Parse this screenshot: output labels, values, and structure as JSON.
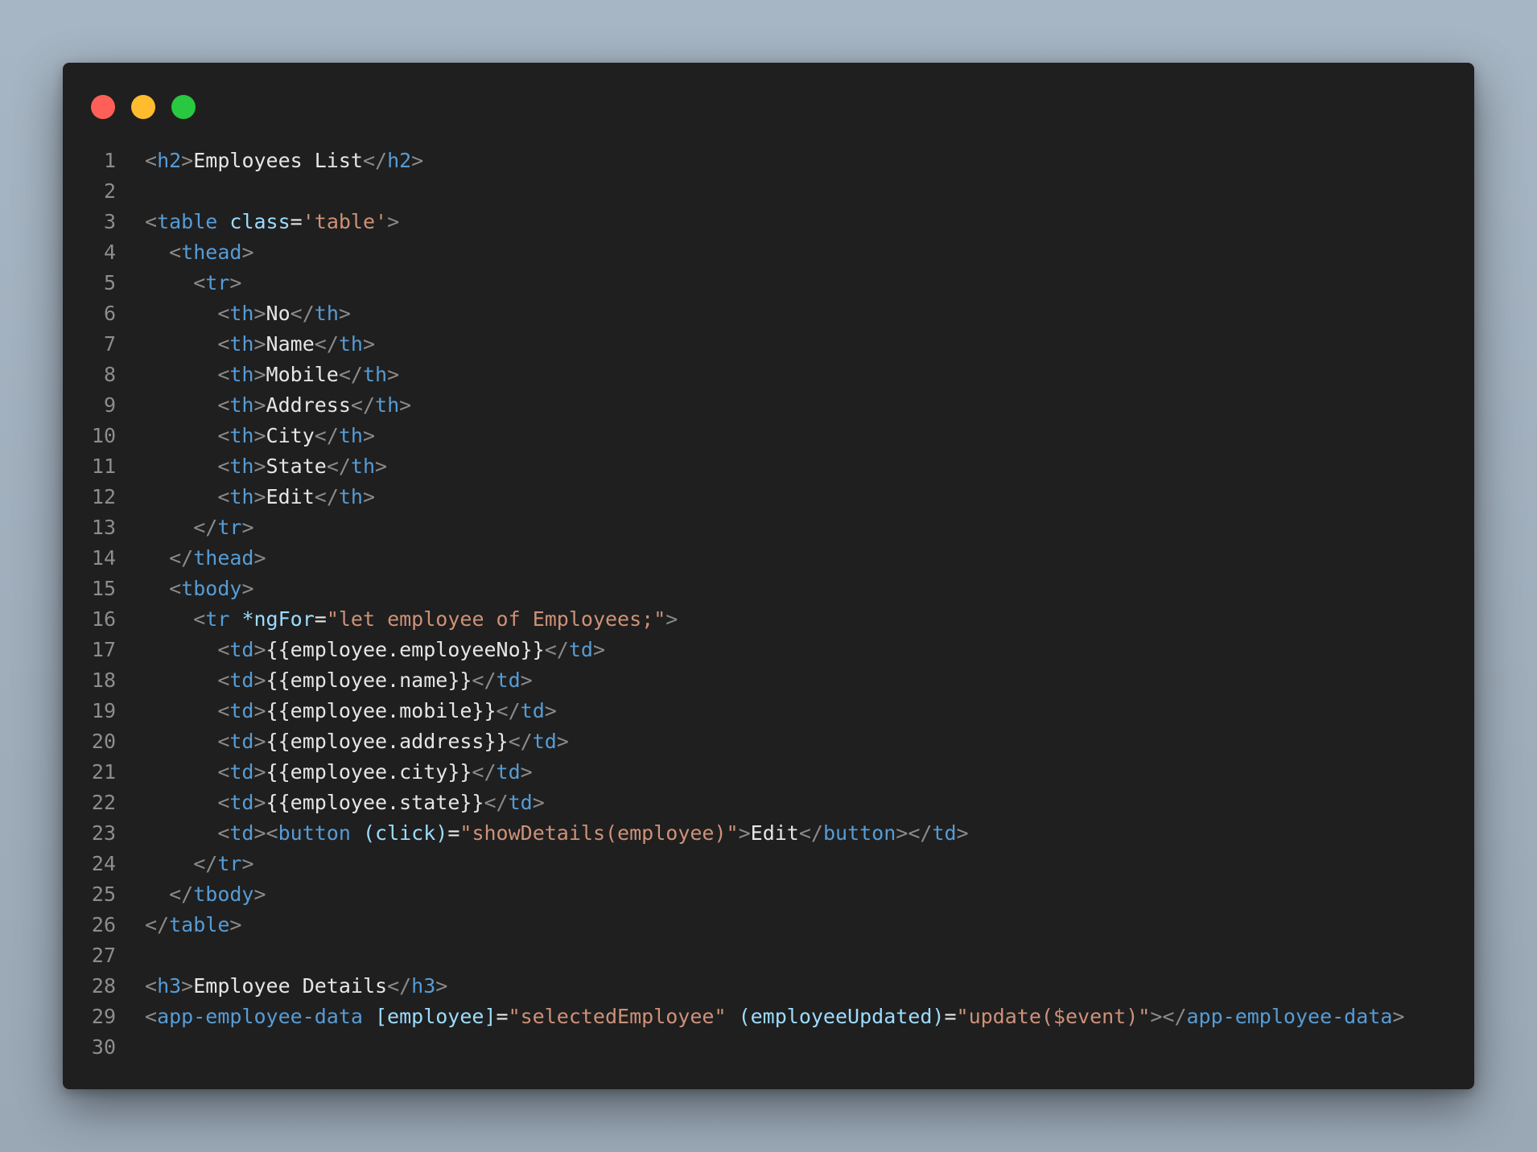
{
  "window": {
    "controls": [
      "close",
      "minimize",
      "maximize"
    ],
    "colors": {
      "background": "#1f1f1f",
      "close": "#ff5f57",
      "minimize": "#febc2e",
      "maximize": "#28c840",
      "tag": "#569cd6",
      "attribute": "#9cdcfe",
      "string": "#ce9178",
      "text": "#e6e6e6",
      "punctuation": "#8b8b8b",
      "line_number": "#8d8d8d"
    }
  },
  "code": {
    "lines": [
      {
        "n": "1",
        "tokens": [
          [
            "p",
            "<"
          ],
          [
            "t",
            "h2"
          ],
          [
            "p",
            ">"
          ],
          [
            "x",
            "Employees List"
          ],
          [
            "p",
            "</"
          ],
          [
            "t",
            "h2"
          ],
          [
            "p",
            ">"
          ]
        ]
      },
      {
        "n": "2",
        "tokens": []
      },
      {
        "n": "3",
        "tokens": [
          [
            "p",
            "<"
          ],
          [
            "t",
            "table"
          ],
          [
            "x",
            " "
          ],
          [
            "a",
            "class"
          ],
          [
            "x",
            "="
          ],
          [
            "s",
            "'table'"
          ],
          [
            "p",
            ">"
          ]
        ]
      },
      {
        "n": "4",
        "tokens": [
          [
            "x",
            "  "
          ],
          [
            "p",
            "<"
          ],
          [
            "t",
            "thead"
          ],
          [
            "p",
            ">"
          ]
        ]
      },
      {
        "n": "5",
        "tokens": [
          [
            "x",
            "    "
          ],
          [
            "p",
            "<"
          ],
          [
            "t",
            "tr"
          ],
          [
            "p",
            ">"
          ]
        ]
      },
      {
        "n": "6",
        "tokens": [
          [
            "x",
            "      "
          ],
          [
            "p",
            "<"
          ],
          [
            "t",
            "th"
          ],
          [
            "p",
            ">"
          ],
          [
            "x",
            "No"
          ],
          [
            "p",
            "</"
          ],
          [
            "t",
            "th"
          ],
          [
            "p",
            ">"
          ]
        ]
      },
      {
        "n": "7",
        "tokens": [
          [
            "x",
            "      "
          ],
          [
            "p",
            "<"
          ],
          [
            "t",
            "th"
          ],
          [
            "p",
            ">"
          ],
          [
            "x",
            "Name"
          ],
          [
            "p",
            "</"
          ],
          [
            "t",
            "th"
          ],
          [
            "p",
            ">"
          ]
        ]
      },
      {
        "n": "8",
        "tokens": [
          [
            "x",
            "      "
          ],
          [
            "p",
            "<"
          ],
          [
            "t",
            "th"
          ],
          [
            "p",
            ">"
          ],
          [
            "x",
            "Mobile"
          ],
          [
            "p",
            "</"
          ],
          [
            "t",
            "th"
          ],
          [
            "p",
            ">"
          ]
        ]
      },
      {
        "n": "9",
        "tokens": [
          [
            "x",
            "      "
          ],
          [
            "p",
            "<"
          ],
          [
            "t",
            "th"
          ],
          [
            "p",
            ">"
          ],
          [
            "x",
            "Address"
          ],
          [
            "p",
            "</"
          ],
          [
            "t",
            "th"
          ],
          [
            "p",
            ">"
          ]
        ]
      },
      {
        "n": "10",
        "tokens": [
          [
            "x",
            "      "
          ],
          [
            "p",
            "<"
          ],
          [
            "t",
            "th"
          ],
          [
            "p",
            ">"
          ],
          [
            "x",
            "City"
          ],
          [
            "p",
            "</"
          ],
          [
            "t",
            "th"
          ],
          [
            "p",
            ">"
          ]
        ]
      },
      {
        "n": "11",
        "tokens": [
          [
            "x",
            "      "
          ],
          [
            "p",
            "<"
          ],
          [
            "t",
            "th"
          ],
          [
            "p",
            ">"
          ],
          [
            "x",
            "State"
          ],
          [
            "p",
            "</"
          ],
          [
            "t",
            "th"
          ],
          [
            "p",
            ">"
          ]
        ]
      },
      {
        "n": "12",
        "tokens": [
          [
            "x",
            "      "
          ],
          [
            "p",
            "<"
          ],
          [
            "t",
            "th"
          ],
          [
            "p",
            ">"
          ],
          [
            "x",
            "Edit"
          ],
          [
            "p",
            "</"
          ],
          [
            "t",
            "th"
          ],
          [
            "p",
            ">"
          ]
        ]
      },
      {
        "n": "13",
        "tokens": [
          [
            "x",
            "    "
          ],
          [
            "p",
            "</"
          ],
          [
            "t",
            "tr"
          ],
          [
            "p",
            ">"
          ]
        ]
      },
      {
        "n": "14",
        "tokens": [
          [
            "x",
            "  "
          ],
          [
            "p",
            "</"
          ],
          [
            "t",
            "thead"
          ],
          [
            "p",
            ">"
          ]
        ]
      },
      {
        "n": "15",
        "tokens": [
          [
            "x",
            "  "
          ],
          [
            "p",
            "<"
          ],
          [
            "t",
            "tbody"
          ],
          [
            "p",
            ">"
          ]
        ]
      },
      {
        "n": "16",
        "tokens": [
          [
            "x",
            "    "
          ],
          [
            "p",
            "<"
          ],
          [
            "t",
            "tr"
          ],
          [
            "x",
            " "
          ],
          [
            "a",
            "*ngFor"
          ],
          [
            "x",
            "="
          ],
          [
            "s",
            "\"let employee of Employees;\""
          ],
          [
            "p",
            ">"
          ]
        ]
      },
      {
        "n": "17",
        "tokens": [
          [
            "x",
            "      "
          ],
          [
            "p",
            "<"
          ],
          [
            "t",
            "td"
          ],
          [
            "p",
            ">"
          ],
          [
            "x",
            "{{employee.employeeNo}}"
          ],
          [
            "p",
            "</"
          ],
          [
            "t",
            "td"
          ],
          [
            "p",
            ">"
          ]
        ]
      },
      {
        "n": "18",
        "tokens": [
          [
            "x",
            "      "
          ],
          [
            "p",
            "<"
          ],
          [
            "t",
            "td"
          ],
          [
            "p",
            ">"
          ],
          [
            "x",
            "{{employee.name}}"
          ],
          [
            "p",
            "</"
          ],
          [
            "t",
            "td"
          ],
          [
            "p",
            ">"
          ]
        ]
      },
      {
        "n": "19",
        "tokens": [
          [
            "x",
            "      "
          ],
          [
            "p",
            "<"
          ],
          [
            "t",
            "td"
          ],
          [
            "p",
            ">"
          ],
          [
            "x",
            "{{employee.mobile}}"
          ],
          [
            "p",
            "</"
          ],
          [
            "t",
            "td"
          ],
          [
            "p",
            ">"
          ]
        ]
      },
      {
        "n": "20",
        "tokens": [
          [
            "x",
            "      "
          ],
          [
            "p",
            "<"
          ],
          [
            "t",
            "td"
          ],
          [
            "p",
            ">"
          ],
          [
            "x",
            "{{employee.address}}"
          ],
          [
            "p",
            "</"
          ],
          [
            "t",
            "td"
          ],
          [
            "p",
            ">"
          ]
        ]
      },
      {
        "n": "21",
        "tokens": [
          [
            "x",
            "      "
          ],
          [
            "p",
            "<"
          ],
          [
            "t",
            "td"
          ],
          [
            "p",
            ">"
          ],
          [
            "x",
            "{{employee.city}}"
          ],
          [
            "p",
            "</"
          ],
          [
            "t",
            "td"
          ],
          [
            "p",
            ">"
          ]
        ]
      },
      {
        "n": "22",
        "tokens": [
          [
            "x",
            "      "
          ],
          [
            "p",
            "<"
          ],
          [
            "t",
            "td"
          ],
          [
            "p",
            ">"
          ],
          [
            "x",
            "{{employee.state}}"
          ],
          [
            "p",
            "</"
          ],
          [
            "t",
            "td"
          ],
          [
            "p",
            ">"
          ]
        ]
      },
      {
        "n": "23",
        "tokens": [
          [
            "x",
            "      "
          ],
          [
            "p",
            "<"
          ],
          [
            "t",
            "td"
          ],
          [
            "p",
            "><"
          ],
          [
            "t",
            "button"
          ],
          [
            "x",
            " "
          ],
          [
            "a",
            "(click)"
          ],
          [
            "x",
            "="
          ],
          [
            "s",
            "\"showDetails(employee)\""
          ],
          [
            "p",
            ">"
          ],
          [
            "x",
            "Edit"
          ],
          [
            "p",
            "</"
          ],
          [
            "t",
            "button"
          ],
          [
            "p",
            "></"
          ],
          [
            "t",
            "td"
          ],
          [
            "p",
            ">"
          ]
        ]
      },
      {
        "n": "24",
        "tokens": [
          [
            "x",
            "    "
          ],
          [
            "p",
            "</"
          ],
          [
            "t",
            "tr"
          ],
          [
            "p",
            ">"
          ]
        ]
      },
      {
        "n": "25",
        "tokens": [
          [
            "x",
            "  "
          ],
          [
            "p",
            "</"
          ],
          [
            "t",
            "tbody"
          ],
          [
            "p",
            ">"
          ]
        ]
      },
      {
        "n": "26",
        "tokens": [
          [
            "p",
            "</"
          ],
          [
            "t",
            "table"
          ],
          [
            "p",
            ">"
          ]
        ]
      },
      {
        "n": "27",
        "tokens": []
      },
      {
        "n": "28",
        "tokens": [
          [
            "p",
            "<"
          ],
          [
            "t",
            "h3"
          ],
          [
            "p",
            ">"
          ],
          [
            "x",
            "Employee Details"
          ],
          [
            "p",
            "</"
          ],
          [
            "t",
            "h3"
          ],
          [
            "p",
            ">"
          ]
        ]
      },
      {
        "n": "29",
        "tokens": [
          [
            "p",
            "<"
          ],
          [
            "t",
            "app-employee-data"
          ],
          [
            "x",
            " "
          ],
          [
            "a",
            "[employee]"
          ],
          [
            "x",
            "="
          ],
          [
            "s",
            "\"selectedEmployee\""
          ],
          [
            "x",
            " "
          ],
          [
            "a",
            "(employeeUpdated)"
          ],
          [
            "x",
            "="
          ],
          [
            "s",
            "\"update($event)\""
          ],
          [
            "p",
            "></"
          ],
          [
            "t",
            "app-employee-data"
          ],
          [
            "p",
            ">"
          ]
        ]
      },
      {
        "n": "30",
        "tokens": []
      }
    ]
  }
}
